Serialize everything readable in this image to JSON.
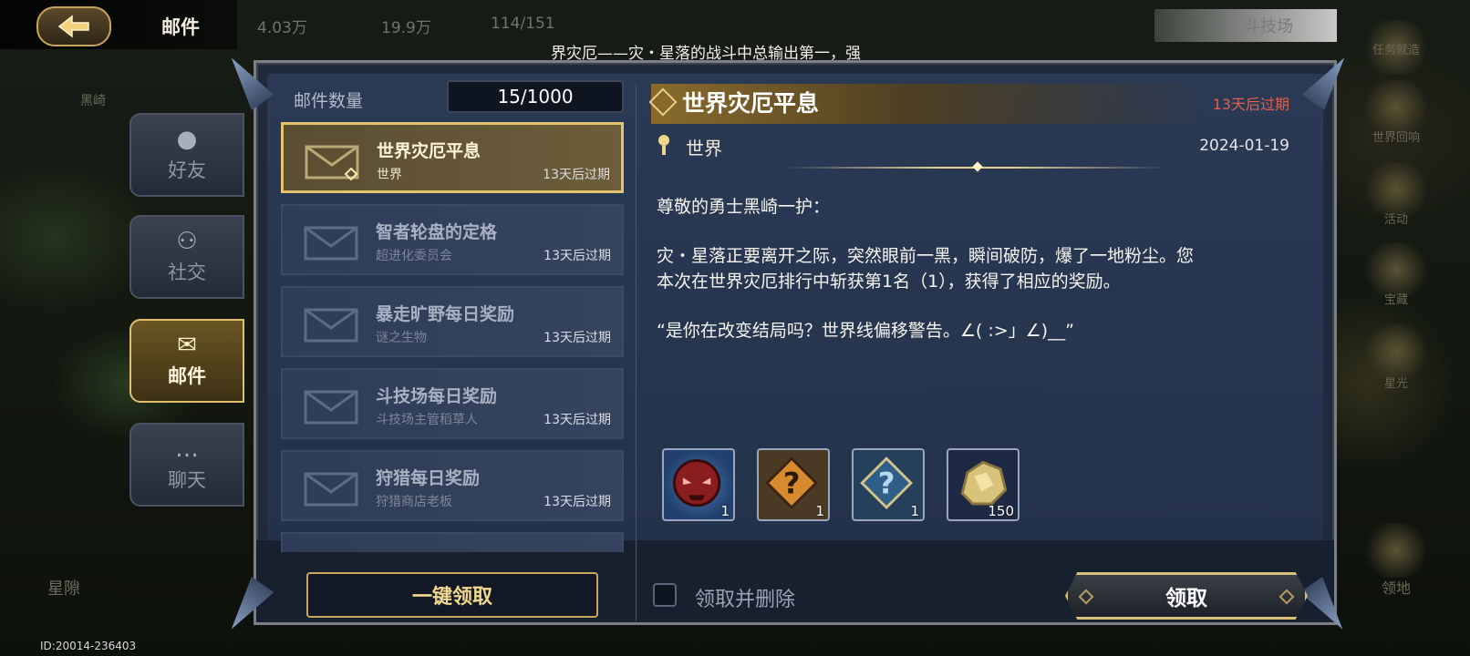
{
  "header": {
    "title": "邮件",
    "resources": [
      "4.03万",
      "19.9万",
      "114/151"
    ],
    "ticker": "界灾厄——灾・星落的战斗中总输出第一，强",
    "arena_label": "斗技场"
  },
  "map_labels": {
    "left_top": "黑崎",
    "left_bottom": "星隙",
    "right": [
      "任务就造",
      "世界回响",
      "活动",
      "宝藏",
      "星光",
      "领地"
    ]
  },
  "tabs": [
    {
      "label": "好友",
      "icon": "friend-icon"
    },
    {
      "label": "社交",
      "icon": "social-icon"
    },
    {
      "label": "邮件",
      "icon": "mail-icon",
      "active": true
    },
    {
      "label": "聊天",
      "icon": "chat-icon"
    }
  ],
  "mail_count": {
    "label": "邮件数量",
    "value": "15/1000"
  },
  "mails": [
    {
      "title": "世界灾厄平息",
      "sender": "世界",
      "expire": "13天后过期",
      "active": true
    },
    {
      "title": "智者轮盘的定格",
      "sender": "超进化委员会",
      "expire": "13天后过期"
    },
    {
      "title": "暴走旷野每日奖励",
      "sender": "谜之生物",
      "expire": "13天后过期"
    },
    {
      "title": "斗技场每日奖励",
      "sender": "斗技场主管稻草人",
      "expire": "13天后过期"
    },
    {
      "title": "狩猎每日奖励",
      "sender": "狩猎商店老板",
      "expire": "13天后过期"
    }
  ],
  "detail": {
    "title": "世界灾厄平息",
    "expire": "13天后过期",
    "sender": "世界",
    "date": "2024-01-19",
    "greeting": "尊敬的勇士黑崎一护：",
    "line1": "灾・星落正要离开之际，突然眼前一黑，瞬间破防，爆了一地粉尘。您",
    "line2": "本次在世界灾厄排行中斩获第1名（1），获得了相应的奖励。",
    "quote": "“是你在改变结局吗？世界线偏移警告。∠( :>」∠)__”",
    "rewards": [
      {
        "icon": "demon-mask-icon",
        "qty": "1"
      },
      {
        "icon": "mystery-box-orange-icon",
        "qty": "1"
      },
      {
        "icon": "mystery-box-blue-icon",
        "qty": "1"
      },
      {
        "icon": "gold-ore-icon",
        "qty": "150"
      }
    ]
  },
  "actions": {
    "claim_all": "一键领取",
    "claim_delete": "领取并删除",
    "claim": "领取"
  },
  "footer": {
    "id_text": "ID:20014-236403"
  },
  "colors": {
    "accent_gold": "#e2c36e",
    "expire_red": "#e35f4c",
    "panel_blue": "#2a3a55"
  }
}
